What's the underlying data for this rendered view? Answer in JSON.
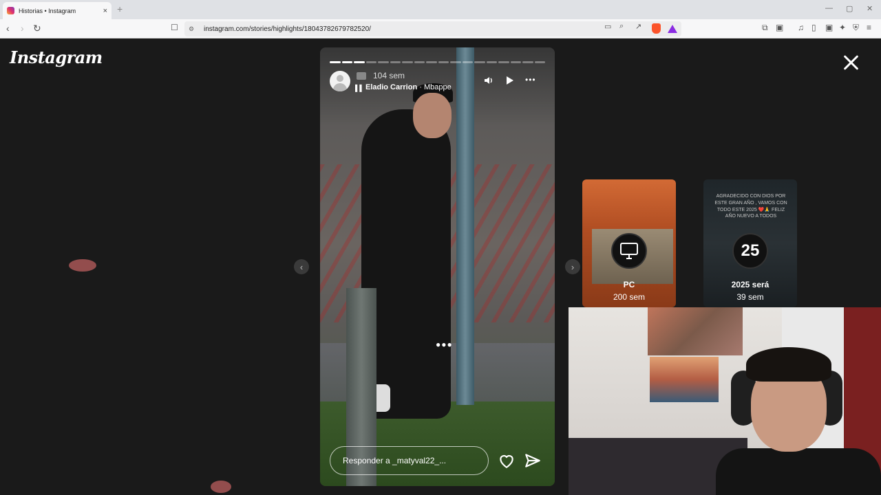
{
  "browser": {
    "tab_title": "Historias • Instagram",
    "tab_close": "×",
    "new_tab": "+",
    "url": "instagram.com/stories/highlights/18043782679782520/"
  },
  "icons": {
    "back": "‹",
    "forward": "›",
    "reload": "↻",
    "bookmark": "☐",
    "cast": "▭",
    "zoom": "⌕",
    "share": "↗",
    "extensions": "⧉",
    "media": "♫",
    "sidebar": "▯",
    "wallet": "▣",
    "leo": "✦",
    "vpn": "⛨",
    "menu": "≡",
    "minimize": "—",
    "maximize": "▢",
    "close": "✕",
    "prev": "‹",
    "next": "›"
  },
  "page": {
    "logo": "Instagram"
  },
  "story": {
    "progress_total": 18,
    "progress_done": 3,
    "time": "104 sem",
    "artist": "Eladio Carrion",
    "separator": " · ",
    "track": "Mbappe",
    "audio_glyph": "▌▌",
    "mute_glyph": "🔈",
    "more_glyph": "•••",
    "center_dots": "●●●",
    "reply_placeholder": "Responder a _matyval22_..."
  },
  "highlights": [
    {
      "name": "PC",
      "meta": "200 sem"
    },
    {
      "name": "2025 será",
      "meta": "39 sem",
      "circle_text": "25",
      "note": "Agradecido con Dios por este gran año , vamos con todo este 2025 ❤️🙏 Feliz año nuevo a todos"
    }
  ]
}
